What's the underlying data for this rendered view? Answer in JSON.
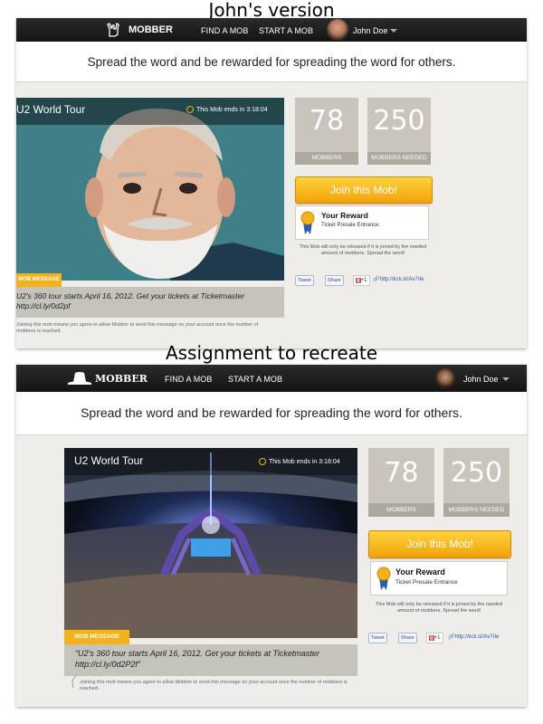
{
  "captions": {
    "top": "John's version",
    "middle": "Assignment to recreate"
  },
  "colors": {
    "nav_bg": "#1c1c1c",
    "accent_yellow": "#f3b21a",
    "stat_bg": "#c9c5bd",
    "page_bg": "#efedea"
  },
  "johns_version": {
    "nav": {
      "logo": "MOBBER",
      "logo_icon": "hand-horns-icon",
      "find": "FIND A MOB",
      "start": "START A MOB",
      "user": "John Doe"
    },
    "tagline": "Spread the word and be rewarded for spreading the word for others.",
    "campaign": {
      "title": "U2 World Tour",
      "timer": "This Mob ends in 3:18:04",
      "image": "illustrated bearded man portrait"
    },
    "stats": {
      "mobbers_value": "78",
      "mobbers_label": "MOBBERS",
      "needed_value": "250",
      "needed_label": "MOBBERS NEEDED"
    },
    "join_label": "Join this Mob!",
    "reward": {
      "title": "Your Reward",
      "subtitle": "Ticket Presale Entrance"
    },
    "release_note": "This Mob will only be released if it is joined by the needed amount of mobbers. Spread the word!",
    "share": {
      "tweet": "Tweet",
      "share": "Share",
      "gplus": "+1",
      "url": "http://kck.st/Av7rle"
    },
    "message": {
      "badge": "MOB MESSAGE",
      "text": "U2's 360 tour starts April 16, 2012. Get your tickets at Ticketmaster http://cl.ly/0d2pf"
    },
    "disclaimer": "Joining this mob means you agree to allow Mobber to send this message on your account once the number of mobbers is reached."
  },
  "assignment": {
    "nav": {
      "logo": "MOBBER",
      "logo_icon": "hat-icon",
      "find": "FIND A MOB",
      "start": "START A MOB",
      "user": "John Doe"
    },
    "tagline": "Spread the word and be rewarded for spreading the word for others.",
    "campaign": {
      "title": "U2 World Tour",
      "timer": "This Mob ends in 3:18:04",
      "image": "U2 360 stadium concert stage"
    },
    "stats": {
      "mobbers_value": "78",
      "mobbers_label": "MOBBERS",
      "needed_value": "250",
      "needed_label": "MOBBERS NEEDED"
    },
    "join_label": "Join this Mob!",
    "reward": {
      "title": "Your Reward",
      "subtitle": "Ticket Presale Entrance"
    },
    "release_note": "This Mob will only be released if it is joined by the needed amount of mobbers. Spread the word!",
    "share": {
      "tweet": "Tweet",
      "share": "Share",
      "gplus": "+1",
      "url": "http://kck.st/Av7rle"
    },
    "message": {
      "badge": "MOB MESSAGE",
      "text": "“U2's 360 tour starts April 16, 2012. Get your tickets at Ticketmaster http://cl.ly/0d2P2f”"
    },
    "disclaimer": "Joining this mob means you agree to allow Mobber to send this message on your account once the number of mobbers is reached."
  }
}
